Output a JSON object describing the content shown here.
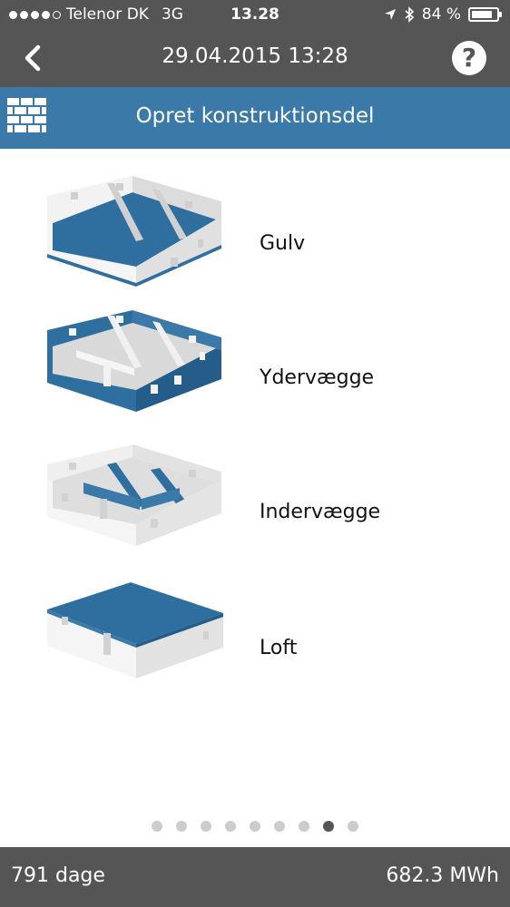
{
  "status_bar": {
    "carrier": "Telenor DK",
    "network": "3G",
    "time": "13.28",
    "battery": "84 %",
    "battery_level": 0.84
  },
  "nav": {
    "title": "29.04.2015 13:28",
    "back_icon": "chevron-left-icon",
    "help_label": "?"
  },
  "section": {
    "title": "Opret konstruktionsdel",
    "icon": "brick-wall-icon"
  },
  "options": [
    {
      "label": "Gulv"
    },
    {
      "label": "Ydervægge"
    },
    {
      "label": "Indervægge"
    },
    {
      "label": "Loft"
    }
  ],
  "pager": {
    "count": 9,
    "active_index": 7
  },
  "footer": {
    "days": "791 dage",
    "energy": "682.3 MWh"
  },
  "colors": {
    "bar": "#555555",
    "accent": "#3a79a8",
    "highlight": "#2f6fa0"
  }
}
